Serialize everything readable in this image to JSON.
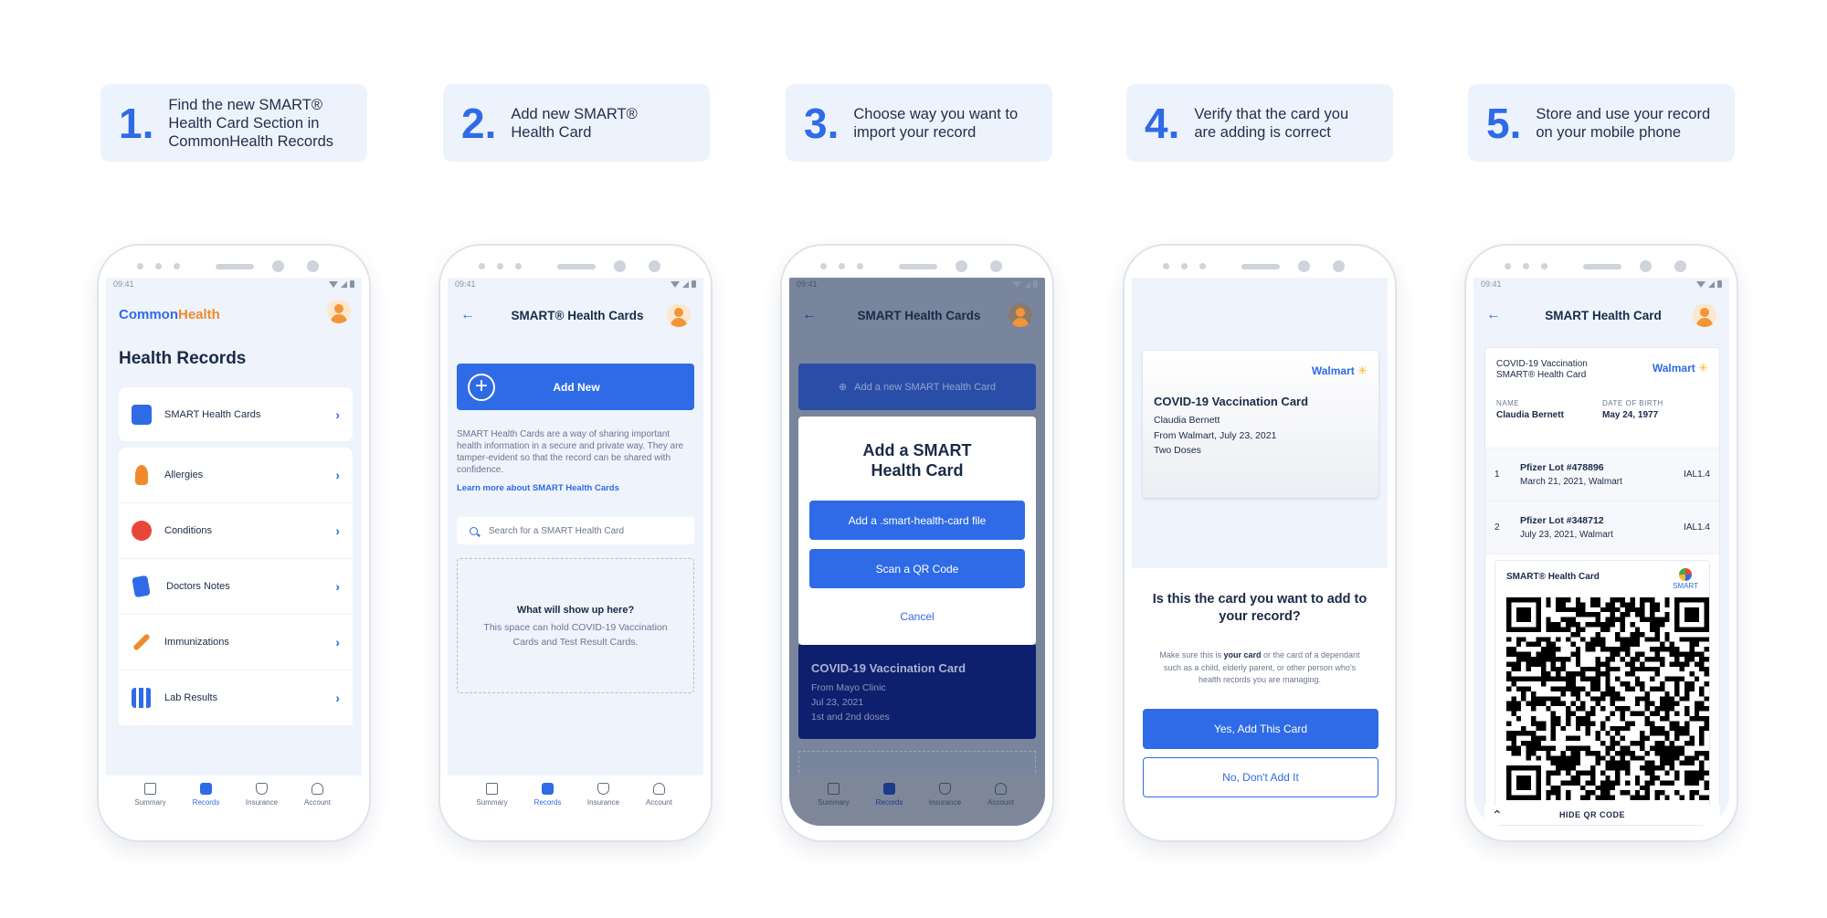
{
  "steps": [
    {
      "num": "1.",
      "text": "Find the new SMART®\nHealth Card Section in\nCommonHealth Records"
    },
    {
      "num": "2.",
      "text": "Add new SMART®\nHealth Card"
    },
    {
      "num": "3.",
      "text": "Choose way you want to\nimport your record"
    },
    {
      "num": "4.",
      "text": "Verify that the card you\nare adding is correct"
    },
    {
      "num": "5.",
      "text": "Store and use your record\non your mobile phone"
    }
  ],
  "status_time": "09:41",
  "nav": [
    "Summary",
    "Records",
    "Insurance",
    "Account"
  ],
  "phone1": {
    "brand_a": "Common",
    "brand_b": "Health",
    "title": "Health Records",
    "items": [
      "SMART Health Cards",
      "Allergies",
      "Conditions",
      "Doctors Notes",
      "Immunizations",
      "Lab Results"
    ],
    "item_icons": [
      "smart-card-icon",
      "allergy-icon",
      "heart-icon",
      "notes-icon",
      "syringe-icon",
      "lab-icon"
    ],
    "item_colors": [
      "#2f6be6",
      "#f08a2c",
      "#e8463a",
      "#2f6be6",
      "#f08a2c",
      "#2f6be6"
    ]
  },
  "phone2": {
    "title": "SMART® Health Cards",
    "add_new": "Add New",
    "description": "SMART Health Cards are a way of sharing important health information in a secure and private way. They are tamper-evident so that the record can be shared with confidence.",
    "learn_more": "Learn more about SMART Health Cards",
    "search_placeholder": "Search for a SMART Health Card",
    "empty_title": "What will show up here?",
    "empty_body": "This space can hold COVID-19 Vaccination Cards and Test Result Cards."
  },
  "phone3": {
    "title": "SMART Health Cards",
    "bg_button": "Add a new SMART Health Card",
    "modal_title": "Add a SMART\nHealth Card",
    "option_file": "Add a .smart-health-card file",
    "option_qr": "Scan a QR Code",
    "cancel": "Cancel",
    "bg_card_title": "COVID-19 Vaccination Card",
    "bg_card_from": "From Mayo Clinic",
    "bg_card_date": "Jul 23, 2021",
    "bg_card_doses": "1st and 2nd doses"
  },
  "phone4": {
    "issuer": "Walmart",
    "card_title": "COVID-19 Vaccination Card",
    "patient": "Claudia Bernett",
    "from": "From Walmart, July 23, 2021",
    "doses": "Two Doses",
    "question": "Is this the card you want to add to your record?",
    "note_a": "Make sure this is ",
    "note_b": "your card",
    "note_c": " or the card of a dependant such as a child, elderly parent, or other person who's health records you are managing.",
    "yes": "Yes, Add This Card",
    "no": "No, Don't Add It"
  },
  "phone5": {
    "title": "SMART Health Card",
    "vacc_title": "COVID-19 Vaccination\nSMART® Health Card",
    "issuer": "Walmart",
    "name_label": "NAME",
    "name_value": "Claudia Bernett",
    "dob_label": "DATE OF BIRTH",
    "dob_value": "May 24, 1977",
    "doses": [
      {
        "n": "1",
        "lot": "Pfizer Lot #478896",
        "date": "March 21, 2021, Walmart",
        "ial": "IAL1.4"
      },
      {
        "n": "2",
        "lot": "Pfizer Lot #348712",
        "date": "July 23, 2021, Walmart",
        "ial": "IAL1.4"
      }
    ],
    "qr_title": "SMART® Health Card",
    "smart_logo": "SMART",
    "hide_qr": "HIDE QR CODE"
  }
}
